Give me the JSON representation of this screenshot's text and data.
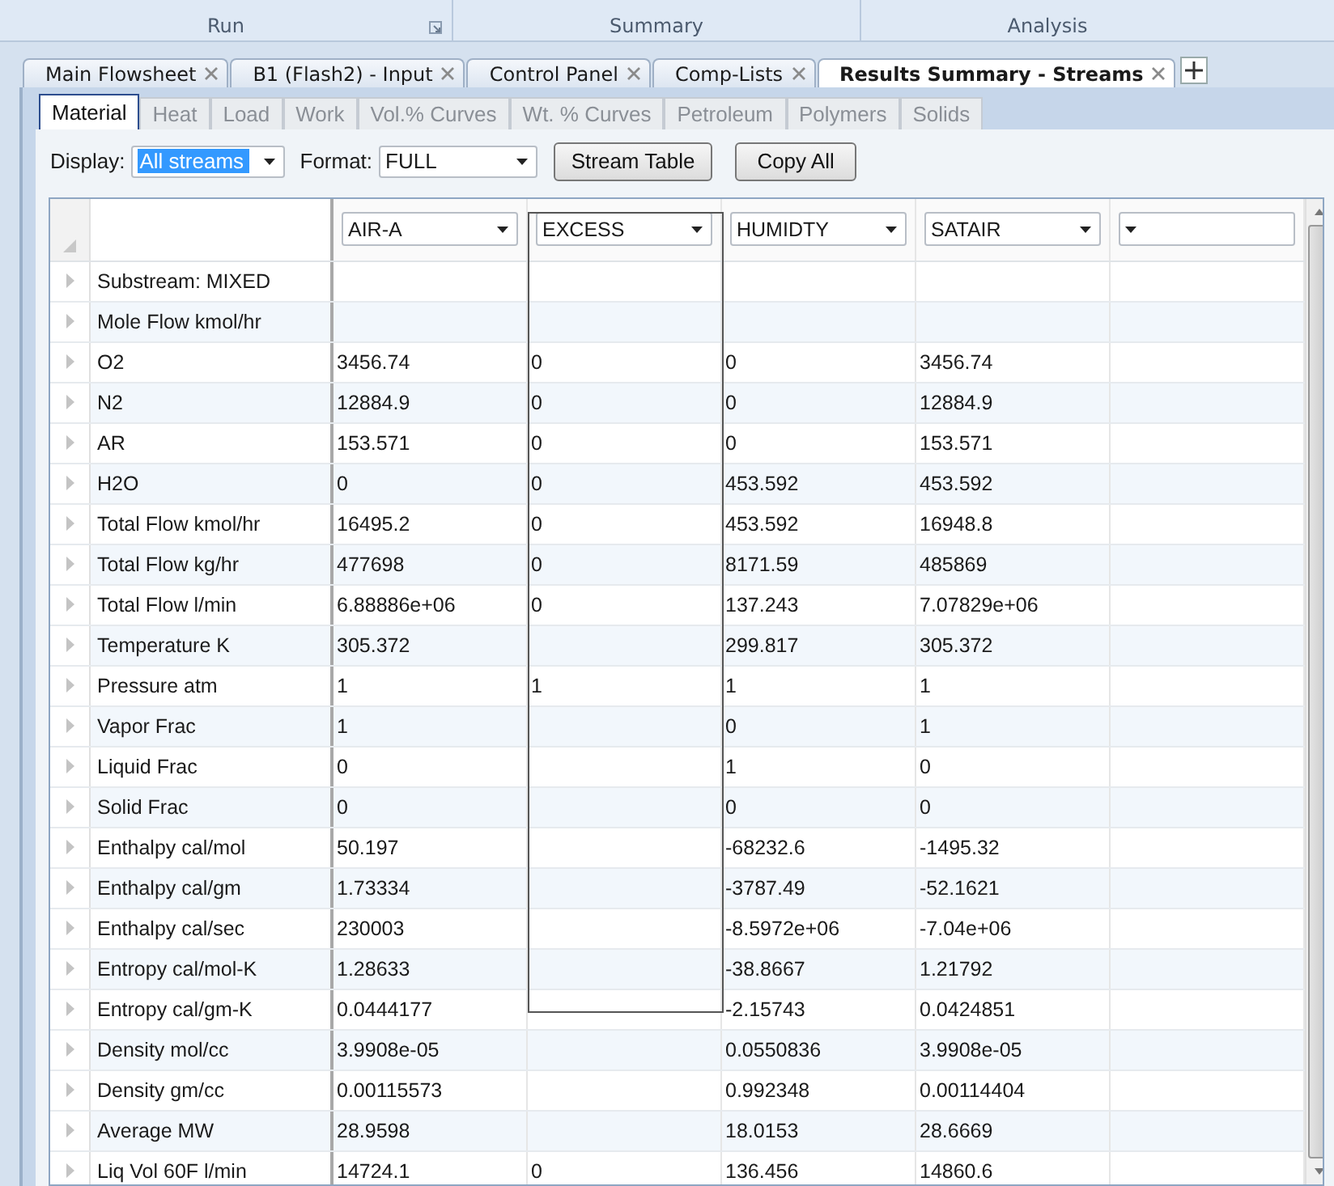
{
  "ribbon_groups": [
    {
      "label": "Run",
      "launcher": true
    },
    {
      "label": "Summary"
    },
    {
      "label": "Analysis"
    }
  ],
  "document_tabs": [
    {
      "label": "Main Flowsheet",
      "selected": false
    },
    {
      "label": "B1 (Flash2) - Input",
      "selected": false
    },
    {
      "label": "Control Panel",
      "selected": false
    },
    {
      "label": "Comp-Lists",
      "selected": false
    },
    {
      "label": "Results Summary - Streams",
      "selected": true
    }
  ],
  "sub_tabs": [
    {
      "label": "Material",
      "selected": true
    },
    {
      "label": "Heat",
      "selected": false
    },
    {
      "label": "Load",
      "selected": false
    },
    {
      "label": "Work",
      "selected": false
    },
    {
      "label": "Vol.% Curves",
      "selected": false
    },
    {
      "label": "Wt. % Curves",
      "selected": false
    },
    {
      "label": "Petroleum",
      "selected": false
    },
    {
      "label": "Polymers",
      "selected": false
    },
    {
      "label": "Solids",
      "selected": false
    }
  ],
  "toolbar": {
    "display_label": "Display:",
    "display_value": "All streams",
    "format_label": "Format:",
    "format_value": "FULL",
    "buttons": [
      "Stream Table",
      "Copy All"
    ]
  },
  "table": {
    "columns": [
      {
        "stream": "AIR-A",
        "highlighted": false
      },
      {
        "stream": "EXCESS",
        "highlighted": true
      },
      {
        "stream": "HUMIDTY",
        "highlighted": false
      },
      {
        "stream": "SATAIR",
        "highlighted": false
      },
      {
        "highlighted": false
      }
    ],
    "rows": [
      {
        "label": "Substream: MIXED"
      },
      {
        "label": "Mole Flow kmol/hr"
      },
      {
        "label": "O2",
        "air_a": "3456.74",
        "excess": "0",
        "humidty": "0",
        "satair": "3456.74"
      },
      {
        "label": "N2",
        "air_a": "12884.9",
        "excess": "0",
        "humidty": "0",
        "satair": "12884.9"
      },
      {
        "label": "AR",
        "air_a": "153.571",
        "excess": "0",
        "humidty": "0",
        "satair": "153.571"
      },
      {
        "label": "H2O",
        "air_a": "0",
        "excess": "0",
        "humidty": "453.592",
        "satair": "453.592"
      },
      {
        "label": "Total Flow kmol/hr",
        "air_a": "16495.2",
        "excess": "0",
        "humidty": "453.592",
        "satair": "16948.8"
      },
      {
        "label": "Total Flow kg/hr",
        "air_a": "477698",
        "excess": "0",
        "humidty": "8171.59",
        "satair": "485869"
      },
      {
        "label": "Total Flow l/min",
        "air_a": "6.88886e+06",
        "excess": "0",
        "humidty": "137.243",
        "satair": "7.07829e+06"
      },
      {
        "label": "Temperature K",
        "air_a": "305.372",
        "humidty": "299.817",
        "satair": "305.372"
      },
      {
        "label": "Pressure atm",
        "air_a": "1",
        "excess": "1",
        "humidty": "1",
        "satair": "1"
      },
      {
        "label": "Vapor Frac",
        "air_a": "1",
        "humidty": "0",
        "satair": "1"
      },
      {
        "label": "Liquid Frac",
        "air_a": "0",
        "humidty": "1",
        "satair": "0"
      },
      {
        "label": "Solid Frac",
        "air_a": "0",
        "humidty": "0",
        "satair": "0"
      },
      {
        "label": "Enthalpy cal/mol",
        "air_a": "50.197",
        "humidty": "-68232.6",
        "satair": "-1495.32"
      },
      {
        "label": "Enthalpy cal/gm",
        "air_a": "1.73334",
        "humidty": "-3787.49",
        "satair": "-52.1621"
      },
      {
        "label": "Enthalpy cal/sec",
        "air_a": "230003",
        "humidty": "-8.5972e+06",
        "satair": "-7.04e+06"
      },
      {
        "label": "Entropy cal/mol-K",
        "air_a": "1.28633",
        "humidty": "-38.8667",
        "satair": "1.21792"
      },
      {
        "label": "Entropy cal/gm-K",
        "air_a": "0.0444177",
        "humidty": "-2.15743",
        "satair": "0.0424851"
      },
      {
        "label": "Density mol/cc",
        "air_a": "3.9908e-05",
        "humidty": "0.0550836",
        "satair": "3.9908e-05"
      },
      {
        "label": "Density gm/cc",
        "air_a": "0.00115573",
        "humidty": "0.992348",
        "satair": "0.00114404"
      },
      {
        "label": "Average MW",
        "air_a": "28.9598",
        "humidty": "18.0153",
        "satair": "28.6669"
      },
      {
        "label": "Liq Vol 60F l/min",
        "air_a": "14724.1",
        "excess": "0",
        "humidty": "136.456",
        "satair": "14860.6"
      }
    ]
  }
}
